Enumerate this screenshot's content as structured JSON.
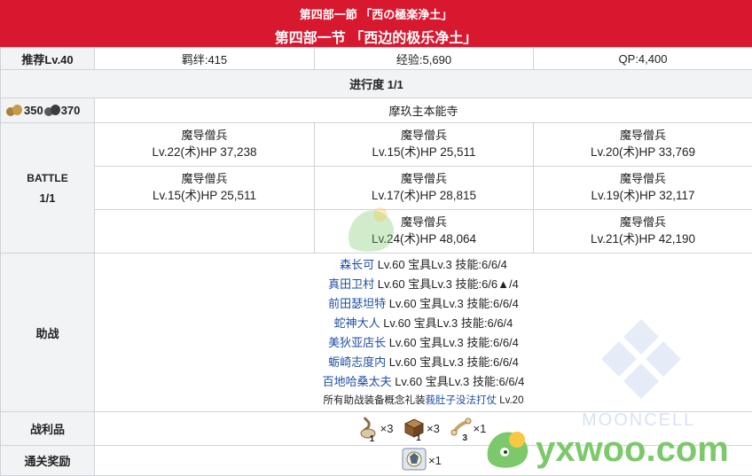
{
  "banner": {
    "subtitle": "第四部一節 「西の極楽浄土」",
    "title": "第四部一节 「西边的极乐净土」"
  },
  "info": {
    "recommend": "推荐Lv.40",
    "bond": "羁绊:415",
    "exp": "经验:5,690",
    "qp": "QP:4,400"
  },
  "progress": "进行度 1/1",
  "cost": {
    "ap": "350",
    "ap2": "370"
  },
  "location": "摩玖主本能寺",
  "battle": {
    "label": "BATTLE",
    "stage": "1/1",
    "enemies": [
      {
        "name": "魔导僧兵",
        "stats": "Lv.22(术)HP 37,238"
      },
      {
        "name": "魔导僧兵",
        "stats": "Lv.15(术)HP 25,511"
      },
      {
        "name": "魔导僧兵",
        "stats": "Lv.20(术)HP 33,769"
      },
      {
        "name": "魔导僧兵",
        "stats": "Lv.15(术)HP 25,511"
      },
      {
        "name": "魔导僧兵",
        "stats": "Lv.17(术)HP 28,815"
      },
      {
        "name": "魔导僧兵",
        "stats": "Lv.19(术)HP 32,117"
      },
      {
        "name": "魔导僧兵",
        "stats": "Lv.24(术)HP 48,064"
      },
      {
        "name": "魔导僧兵",
        "stats": "Lv.21(术)HP 42,190"
      }
    ]
  },
  "support": {
    "label": "助战",
    "entries": [
      {
        "name": "森长可",
        "info": " Lv.60 宝具Lv.3 技能:6/6/4"
      },
      {
        "name": "真田卫村",
        "info": " Lv.60 宝具Lv.3 技能:6/6▲/4"
      },
      {
        "name": "前田瑟坦特",
        "info": " Lv.60 宝具Lv.3 技能:6/6/4"
      },
      {
        "name": "蛇神大人",
        "info": " Lv.60 宝具Lv.3 技能:6/6/4"
      },
      {
        "name": "美狄亚店长",
        "info": " Lv.60 宝具Lv.3 技能:6/6/4"
      },
      {
        "name": "蛎崎志度内",
        "info": " Lv.60 宝具Lv.3 技能:6/6/4"
      },
      {
        "name": "百地哈桑太夫",
        "info": " Lv.60 宝具Lv.3 技能:6/6/4"
      }
    ],
    "footer_prefix": "所有助战装备概念礼装",
    "footer_ce": "莪肚子没法打仗",
    "footer_suffix": " Lv.20"
  },
  "drops": {
    "label": "战利品",
    "items": [
      {
        "icon": "root-material-icon",
        "count": "1",
        "qty": "×3"
      },
      {
        "icon": "wooden-box-icon",
        "count": "1",
        "qty": "×3"
      },
      {
        "icon": "bone-material-icon",
        "count": "3",
        "qty": "×1"
      }
    ]
  },
  "reward": {
    "label": "通关奖励",
    "icon": "servant-coin-icon",
    "qty": "×1"
  },
  "watermarks": {
    "mooncell": "MOONCELL",
    "site": "yxwoo.com"
  },
  "colors": {
    "banner": "#d7182f",
    "support_name": "#1e4fa3",
    "header_bg": "#f2f3f5",
    "watermark_green": "#7cc96b"
  }
}
